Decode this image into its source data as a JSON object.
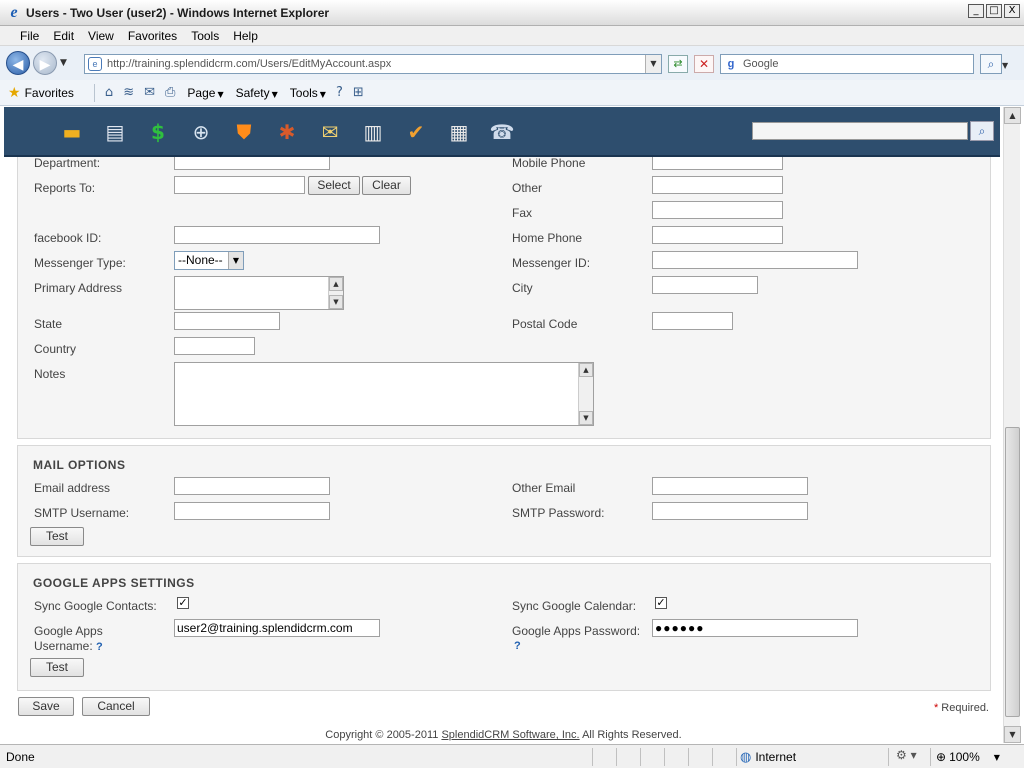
{
  "window": {
    "title": "Users - Two User (user2) - Windows Internet Explorer",
    "minimize": "_",
    "maximize": "□",
    "close": "X"
  },
  "menu": [
    "File",
    "Edit",
    "View",
    "Favorites",
    "Tools",
    "Help"
  ],
  "address": {
    "url": "http://training.splendidcrm.com/Users/EditMyAccount.aspx",
    "search_placeholder": "Google"
  },
  "commandbar": {
    "favorites": "Favorites",
    "page": "Page",
    "safety": "Safety",
    "tools": "Tools"
  },
  "apptoolbar": {
    "icons": [
      "folder-icon",
      "contact-card-icon",
      "dollar-icon",
      "find-icon",
      "shield-icon",
      "bug-icon",
      "mail-icon",
      "document-icon",
      "task-icon",
      "project-icon",
      "phone-icon"
    ]
  },
  "form": {
    "department_label": "Department:",
    "mobile_phone_label": "Mobile Phone",
    "reports_to_label": "Reports To:",
    "select_button": "Select",
    "clear_button": "Clear",
    "other_label": "Other",
    "fax_label": "Fax",
    "facebook_label": "facebook ID:",
    "home_phone_label": "Home Phone",
    "messenger_type_label": "Messenger Type:",
    "messenger_type_value": "--None--",
    "messenger_id_label": "Messenger ID:",
    "primary_address_label": "Primary Address",
    "city_label": "City",
    "state_label": "State",
    "postal_code_label": "Postal Code",
    "country_label": "Country",
    "notes_label": "Notes"
  },
  "mail": {
    "title": "MAIL OPTIONS",
    "email_label": "Email address",
    "other_email_label": "Other Email",
    "smtp_username_label": "SMTP Username:",
    "smtp_password_label": "SMTP Password:",
    "test_button": "Test"
  },
  "google": {
    "title": "GOOGLE APPS SETTINGS",
    "sync_contacts_label": "Sync Google Contacts:",
    "sync_calendar_label": "Sync Google Calendar:",
    "username_label": "Google Apps Username:",
    "username_value": "user2@training.splendidcrm.com",
    "password_label": "Google Apps Password:",
    "password_value": "●●●●●●",
    "help": "?",
    "test_button": "Test"
  },
  "footer": {
    "save_button": "Save",
    "cancel_button": "Cancel",
    "required_mark": "*",
    "required_text": "Required.",
    "copyright_prefix": "Copyright © 2005-2011",
    "copyright_link": "SplendidCRM Software, Inc.",
    "copyright_suffix": "All Rights Reserved."
  },
  "status": {
    "text": "Done",
    "zone": "Internet",
    "zoom": "100%"
  }
}
